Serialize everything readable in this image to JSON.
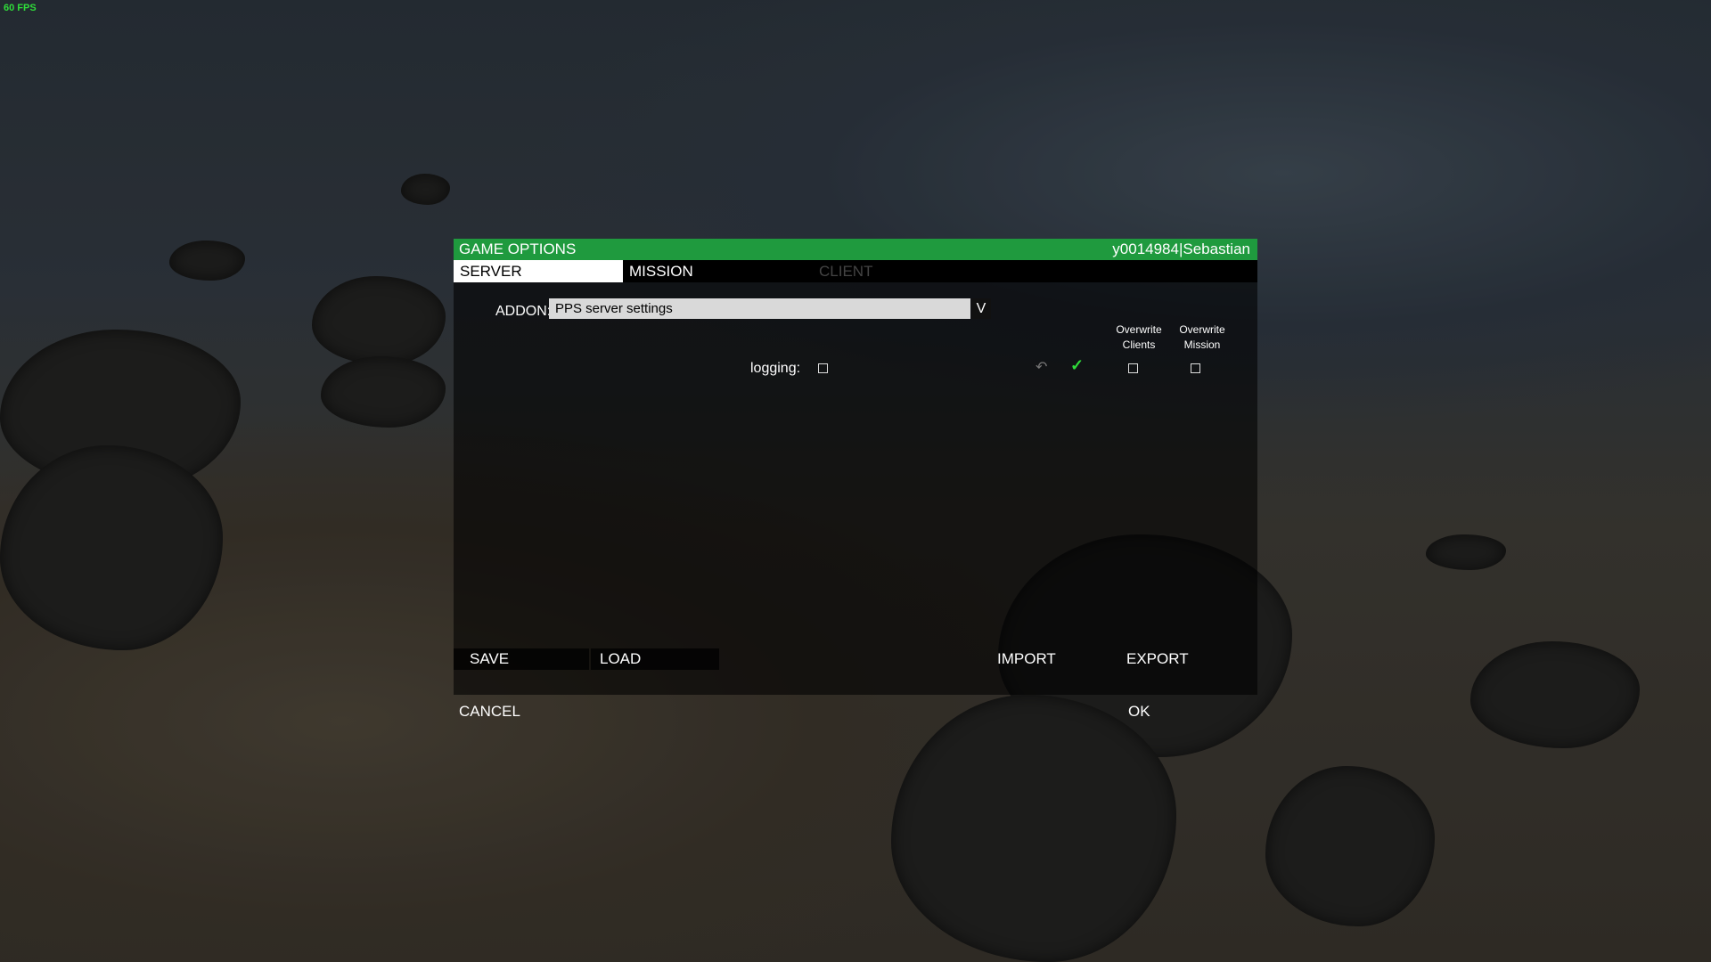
{
  "hud": {
    "fps": "60 FPS"
  },
  "dialog": {
    "title": "GAME OPTIONS",
    "user": "y0014984|Sebastian",
    "tabs": [
      {
        "label": "SERVER",
        "state": "active"
      },
      {
        "label": "MISSION",
        "state": "normal"
      },
      {
        "label": "CLIENT",
        "state": "disabled"
      }
    ],
    "addon": {
      "label": "ADDON:",
      "selected": "PPS server settings",
      "dropdown_symbol": "V"
    },
    "columns": [
      {
        "line1": "Overwrite",
        "line2": "Clients"
      },
      {
        "line1": "Overwrite",
        "line2": "Mission"
      }
    ],
    "settings": [
      {
        "label": "logging:",
        "value_checked": false,
        "default_applied": true,
        "overwrite_clients": false,
        "overwrite_mission": false
      }
    ],
    "buttons": {
      "save": "SAVE",
      "load": "LOAD",
      "import": "IMPORT",
      "export": "EXPORT",
      "cancel": "CANCEL",
      "ok": "OK"
    }
  },
  "colors": {
    "title_bar": "#1f9a3e",
    "check": "#2fdc3a",
    "fps": "#2fdc3a"
  }
}
